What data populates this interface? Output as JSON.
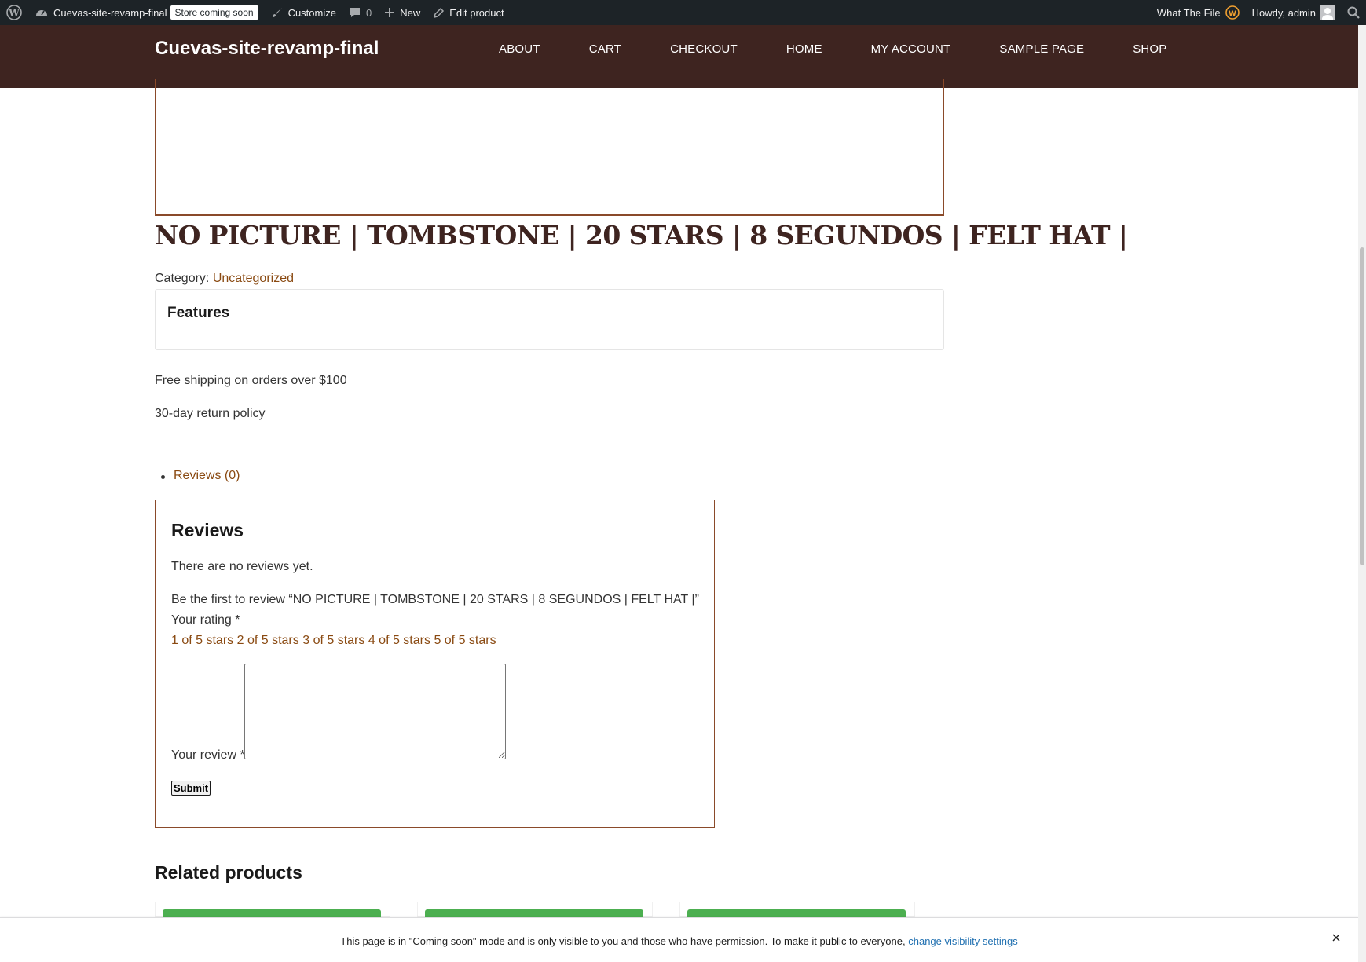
{
  "admin_bar": {
    "site_name": "Cuevas-site-revamp-final",
    "badge": "Store coming soon",
    "customize": "Customize",
    "comments_count": "0",
    "new_label": "New",
    "edit_product": "Edit product",
    "plugin_label": "What The File",
    "howdy": "Howdy, admin"
  },
  "header": {
    "site_title": "Cuevas-site-revamp-final",
    "nav": [
      "ABOUT",
      "CART",
      "CHECKOUT",
      "HOME",
      "MY ACCOUNT",
      "SAMPLE PAGE",
      "SHOP"
    ]
  },
  "product": {
    "title": "NO PICTURE | TOMBSTONE | 20 STARS | 8 SEGUNDOS | FELT HAT |",
    "category_label": "Category:",
    "category_value": "Uncategorized",
    "features_heading": "Features",
    "shipping": "Free shipping on orders over $100",
    "returns": "30-day return policy"
  },
  "tabs": {
    "reviews_tab": "Reviews (0)"
  },
  "reviews": {
    "heading": "Reviews",
    "none": "There are no reviews yet.",
    "be_first": "Be the first to review “NO PICTURE | TOMBSTONE | 20 STARS | 8 SEGUNDOS | FELT HAT |”",
    "rating_label": "Your rating *",
    "stars": [
      "1 of 5 stars",
      "2 of 5 stars",
      "3 of 5 stars",
      "4 of 5 stars",
      "5 of 5 stars"
    ],
    "review_label": "Your review *",
    "submit": "Submit"
  },
  "related": {
    "heading": "Related products"
  },
  "notice": {
    "text": "This page is in \"Coming soon\" mode and is only visible to you and those who have permission. To make it public to everyone,",
    "link": "change visibility settings"
  },
  "colors": {
    "admin_bar_bg": "#1d2327",
    "header_bg": "#3e2420",
    "accent": "#8a4a12",
    "related_green": "#4caf50"
  }
}
